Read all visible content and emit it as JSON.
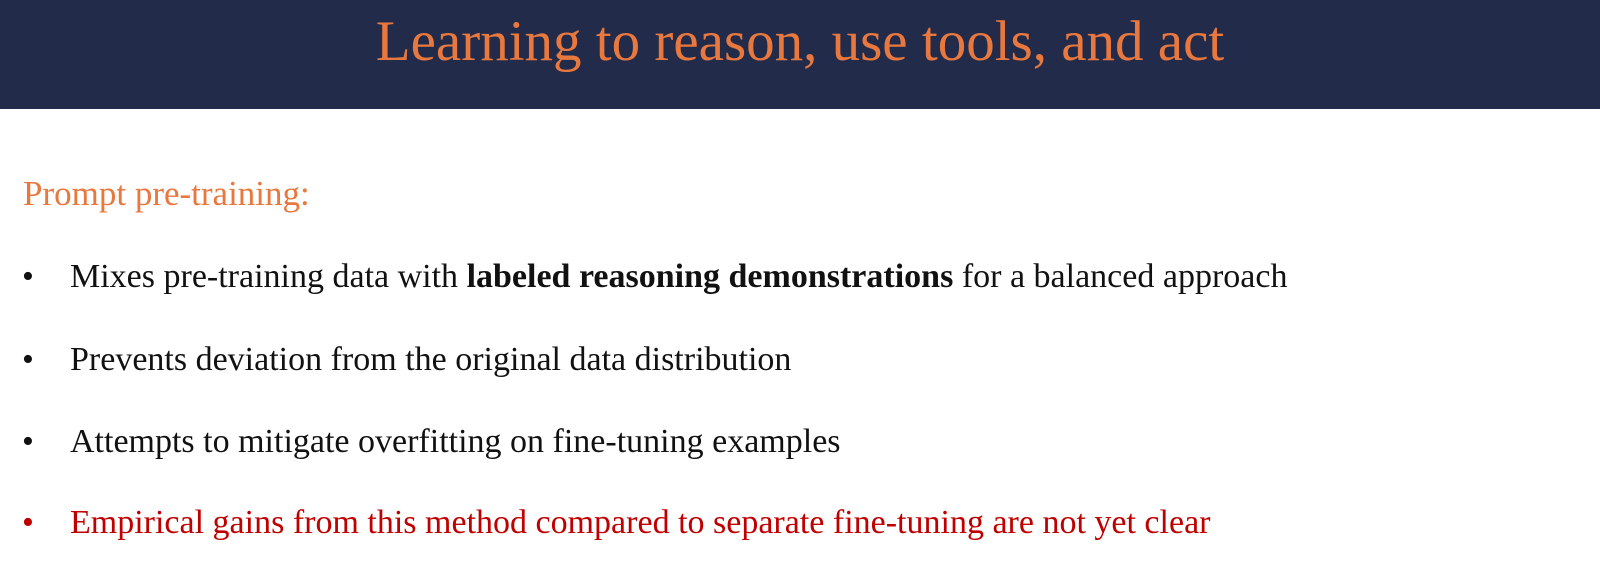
{
  "slide": {
    "title": "Learning to reason, use tools, and act",
    "section_heading": "Prompt pre-training:",
    "bullet_glyph": "•",
    "bullets": [
      {
        "before": "Mixes pre-training data with ",
        "bold": "labeled reasoning demonstrations",
        "after": " for a balanced approach"
      },
      {
        "text": "Prevents deviation from the original data distribution"
      },
      {
        "text": "Attempts to mitigate overfitting on fine-tuning examples"
      },
      {
        "text": "Empirical gains from this method compared to separate fine-tuning are not yet clear"
      }
    ]
  },
  "colors": {
    "header_background": "#222b4a",
    "title_text": "#e8783e",
    "heading_text": "#e8783e",
    "body_text": "#111111",
    "emphasis_text": "#c00000"
  }
}
